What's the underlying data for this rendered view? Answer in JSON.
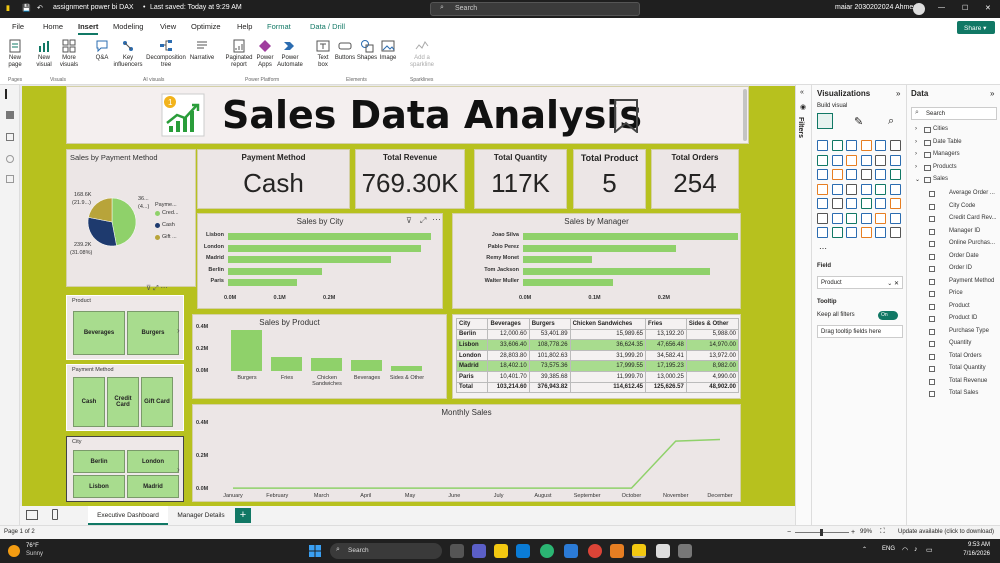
{
  "titlebar": {
    "file": "assignment power bi DAX",
    "saved": "Last saved: Today at 9:29 AM",
    "search": "Search",
    "user": "maiar 2030202024 Ahmed"
  },
  "menu": [
    "File",
    "Home",
    "Insert",
    "Modeling",
    "View",
    "Optimize",
    "Help",
    "Format",
    "Data / Drill"
  ],
  "share": "Share",
  "ribbon": {
    "new_page": "New page",
    "new_visual": "New visual",
    "more_visuals": "More visuals",
    "qa": "Q&A",
    "key_influencers": "Key influencers",
    "decomp_tree": "Decomposition tree",
    "narrative": "Narrative",
    "paginated": "Paginated report",
    "power_apps": "Power Apps",
    "power_automate": "Power Automate",
    "text_box": "Text box",
    "buttons": "Buttons",
    "shapes": "Shapes",
    "image": "Image",
    "sparklines": "Add a sparkline",
    "groups": {
      "pages": "Pages",
      "visuals": "Visuals",
      "ai": "AI visuals",
      "power": "Power Platform",
      "elements": "Elements",
      "spark": "Sparklines"
    }
  },
  "report": {
    "title": "Sales Data Analysis",
    "kpis": [
      {
        "title": "Payment Method",
        "value": "Cash"
      },
      {
        "title": "Total Revenue",
        "value": "769.30K"
      },
      {
        "title": "Total Quantity",
        "value": "117K"
      },
      {
        "title": "Total Product",
        "value": "5"
      },
      {
        "title": "Total Orders",
        "value": "254"
      }
    ],
    "pie": {
      "title": "Sales by Payment Method",
      "label1": "168.6K",
      "label1b": "(21.9...)",
      "label2": "36...",
      "label2b": "(4...)",
      "label3": "239.2K",
      "label3b": "(31.08%)",
      "legend_title": "Payme...",
      "legend": [
        "Cred...",
        "Cash",
        "Gift ..."
      ],
      "slices": [
        {
          "name": "Credit Card",
          "value": 361.5,
          "color": "#8fd16a"
        },
        {
          "name": "Cash",
          "value": 239.2,
          "color": "#1e3a6e"
        },
        {
          "name": "Gift Card",
          "value": 168.6,
          "color": "#b8a43a"
        }
      ]
    },
    "city_chart": {
      "title": "Sales by City",
      "categories": [
        "Lisbon",
        "London",
        "Madrid",
        "Berlin",
        "Paris"
      ],
      "values": [
        0.41,
        0.39,
        0.33,
        0.19,
        0.14
      ],
      "ticks": [
        "0.0M",
        "0.1M",
        "0.2M"
      ]
    },
    "manager_chart": {
      "title": "Sales by Manager",
      "categories": [
        "Joao Silva",
        "Pablo Perez",
        "Remy Monet",
        "Tom Jackson",
        "Walter Muller"
      ],
      "values": [
        0.31,
        0.22,
        0.1,
        0.27,
        0.13
      ],
      "ticks": [
        "0.0M",
        "0.1M",
        "0.2M"
      ]
    },
    "product_chart": {
      "title": "Sales by Product",
      "categories": [
        "Burgers",
        "Fries",
        "Chicken Sandwiches",
        "Beverages",
        "Sides & Other"
      ],
      "values": [
        377,
        126,
        115,
        103,
        49
      ],
      "ticks": [
        "0.4M",
        "0.2M",
        "0.0M"
      ]
    },
    "monthly": {
      "title": "Monthly Sales",
      "months": [
        "January",
        "February",
        "March",
        "April",
        "May",
        "June",
        "July",
        "August",
        "September",
        "October",
        "November",
        "December"
      ],
      "values": [
        0.005,
        0.005,
        0.005,
        0.005,
        0.005,
        0.005,
        0.005,
        0.005,
        0.005,
        0.005,
        0.29,
        0.3
      ],
      "ticks": [
        "0.4M",
        "0.2M",
        "0.0M"
      ]
    },
    "slicers": {
      "product": {
        "title": "Product",
        "items": [
          "Beverages",
          "Burgers"
        ]
      },
      "payment": {
        "title": "Payment Method",
        "items": [
          "Cash",
          "Credit Card",
          "Gift Card"
        ]
      },
      "city": {
        "title": "City",
        "items": [
          "Berlin",
          "London",
          "Lisbon",
          "Madrid"
        ]
      }
    },
    "matrix": {
      "headers": [
        "City",
        "Beverages",
        "Burgers",
        "Chicken Sandwiches",
        "Fries",
        "Sides & Other"
      ],
      "rows": [
        [
          "Berlin",
          "12,000.60",
          "53,401.89",
          "15,989.65",
          "13,192.20",
          "5,988.00"
        ],
        [
          "Lisbon",
          "33,606.40",
          "108,778.26",
          "36,624.35",
          "47,656.48",
          "14,970.00"
        ],
        [
          "London",
          "28,803.80",
          "101,802.63",
          "31,999.20",
          "34,582.41",
          "13,972.00"
        ],
        [
          "Madrid",
          "18,402.10",
          "73,575.36",
          "17,999.55",
          "17,195.23",
          "8,982.00"
        ],
        [
          "Paris",
          "10,401.70",
          "39,385.68",
          "11,999.70",
          "13,000.25",
          "4,990.00"
        ],
        [
          "Total",
          "103,214.60",
          "376,943.82",
          "114,612.45",
          "125,626.57",
          "48,902.00"
        ]
      ]
    }
  },
  "panes": {
    "filters": "Filters",
    "viz_title": "Visualizations",
    "build_visual": "Build visual",
    "field_label": "Field",
    "field_value": "Product",
    "tooltip": "Tooltip",
    "keep_filters": "Keep all filters",
    "toggle": "On",
    "drag": "Drag tooltip fields here",
    "data_title": "Data",
    "search": "Search",
    "tables": [
      "Cities",
      "Date Table",
      "Managers",
      "Products",
      "Sales"
    ],
    "sales_fields": [
      "Average Order ...",
      "City Code",
      "Credit Card Rev...",
      "Manager ID",
      "Online Purchas...",
      "Order Date",
      "Order ID",
      "Payment Method",
      "Price",
      "Product",
      "Product ID",
      "Purchase Type",
      "Quantity",
      "Total Orders",
      "Total Quantity",
      "Total Revenue",
      "Total Sales"
    ]
  },
  "tabs": [
    "Executive Dashboard",
    "Manager Details"
  ],
  "status": {
    "page": "Page 1 of 2",
    "zoom": "99%",
    "update": "Update available (click to download)"
  },
  "taskbar": {
    "temp": "76°F",
    "weather": "Sunny",
    "search": "Search",
    "lang": "ENG",
    "time": "9:53 AM",
    "date": "7/16/2026"
  }
}
